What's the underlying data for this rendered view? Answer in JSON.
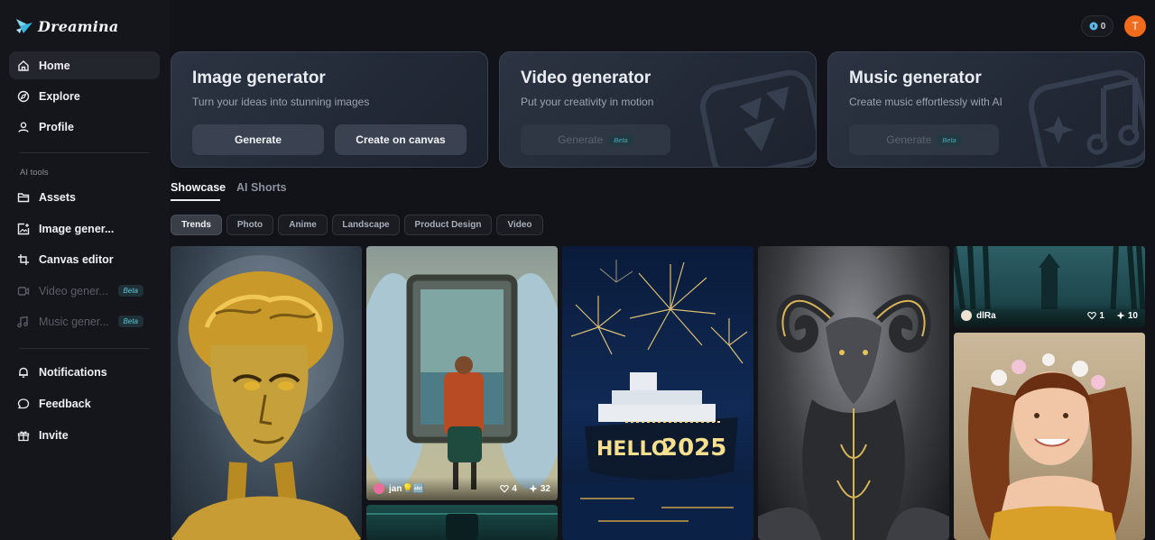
{
  "app": {
    "name": "Dreamina"
  },
  "sidebar": {
    "items": [
      {
        "label": "Home",
        "icon": "home-icon"
      },
      {
        "label": "Explore",
        "icon": "compass-icon"
      },
      {
        "label": "Profile",
        "icon": "user-icon"
      }
    ],
    "section_label": "AI tools",
    "tools": [
      {
        "label": "Assets",
        "icon": "folder-icon"
      },
      {
        "label": "Image gener...",
        "icon": "image-plus-icon"
      },
      {
        "label": "Canvas editor",
        "icon": "crop-icon"
      },
      {
        "label": "Video gener...",
        "icon": "video-icon",
        "badge": "Beta"
      },
      {
        "label": "Music gener...",
        "icon": "music-icon",
        "badge": "Beta"
      }
    ],
    "bottom": [
      {
        "label": "Notifications",
        "icon": "bell-icon"
      },
      {
        "label": "Feedback",
        "icon": "chat-icon"
      },
      {
        "label": "Invite",
        "icon": "gift-icon"
      }
    ]
  },
  "header": {
    "credits": "0",
    "avatar_initial": "T"
  },
  "generators": [
    {
      "title": "Image generator",
      "subtitle": "Turn your ideas into stunning images",
      "buttons": [
        "Generate",
        "Create on canvas"
      ]
    },
    {
      "title": "Video generator",
      "subtitle": "Put your creativity in motion",
      "button": "Generate",
      "badge": "Beta"
    },
    {
      "title": "Music generator",
      "subtitle": "Create music effortlessly with AI",
      "button": "Generate",
      "badge": "Beta"
    }
  ],
  "tabs": [
    "Showcase",
    "AI Shorts"
  ],
  "chips": [
    "Trends",
    "Photo",
    "Anime",
    "Landscape",
    "Product Design",
    "Video"
  ],
  "gallery": {
    "cards": [
      {
        "user": "jan💡🔤",
        "likes": "4",
        "uses": "32"
      },
      {
        "user": "dlRa",
        "likes": "1",
        "uses": "10"
      }
    ]
  },
  "colors": {
    "accent": "#f06b1c",
    "beta": "#58c7d8",
    "bg": "#111318"
  }
}
